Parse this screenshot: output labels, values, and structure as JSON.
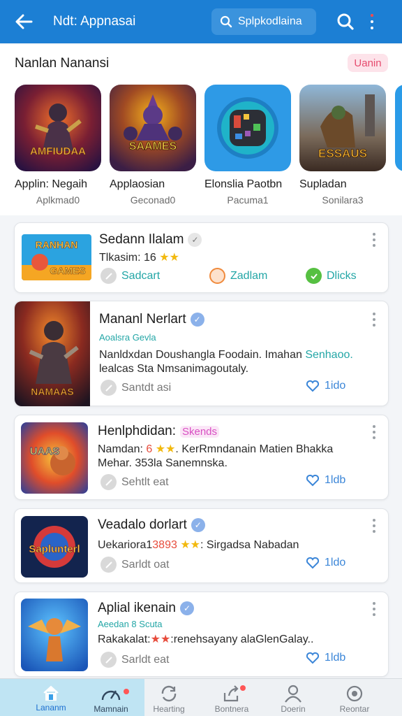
{
  "header": {
    "title": "Ndt: Appnasai",
    "search_label": "Splpkodlaina"
  },
  "featured": {
    "section_title": "Nanlan Nanansi",
    "badge": "Uanin",
    "tiles": [
      {
        "title": "Applin: Negaih",
        "subtitle": "Aplkmad0",
        "art_text": "AMFIUDAA"
      },
      {
        "title": "Applaosian",
        "subtitle": "Geconad0",
        "art_text": "SAAMES"
      },
      {
        "title": "Elonslia Paotbn",
        "subtitle": "Pacuma1",
        "art_text": ""
      },
      {
        "title": "Supladan",
        "subtitle": "Sonilara3",
        "art_text": "ESSAUS"
      }
    ]
  },
  "apps": [
    {
      "title": "Sedann Ilalam",
      "meta_prefix": "Tlkasim: 16",
      "art_line1": "RANHAN",
      "art_line2": "GAMES",
      "actions": [
        "Sadcart",
        "Zadlam",
        "Dlicks"
      ]
    },
    {
      "title": "Mananl Nerlart",
      "developer": "Aoalsra Gevla",
      "desc_line1_a": "Nanldxdan Doushangla Foodain. Imahan ",
      "desc_line1_b": "Senhaoo.",
      "desc_line2": "lealcas Sta Nmsanimagoutaly.",
      "art_text": "NAMAAS",
      "action_left": "Santdt asi",
      "action_right": "1ido"
    },
    {
      "title": "Henlphdidan:",
      "tag": "Skends",
      "desc_line1_a": "Namdan: ",
      "desc_line1_num": "6",
      "desc_line1_b": " KerRmndanain Matien Bhakka",
      "desc_line2": "Mehar. 353la Sanemnska.",
      "art_text": "UAAS",
      "action_left": "Sehtlt eat",
      "action_right": "1ldb"
    },
    {
      "title": "Veadalo dorlart",
      "meta_prefix": "Uekariora1",
      "meta_num": "3893",
      "meta_suffix": ": Sirgadsa Nabadan",
      "art_text": "Saplunterl",
      "action_left": "Sarldt oat",
      "action_right": "1ldo"
    },
    {
      "title": "Aplial ikenain",
      "developer": "Aeedan 8 Scuta",
      "desc_prefix": "Rakakalat:",
      "desc_suffix": ":renehsayany alaGlenGalay..",
      "action_left": "Sarldt eat",
      "action_right": "1ldb"
    }
  ],
  "bottom_nav": [
    {
      "label": "Lananm",
      "icon": "home-icon"
    },
    {
      "label": "Mamnain",
      "icon": "gauge-icon"
    },
    {
      "label": "Hearting",
      "icon": "refresh-icon"
    },
    {
      "label": "Bontnera",
      "icon": "share-icon"
    },
    {
      "label": "Doerin",
      "icon": "profile-icon"
    },
    {
      "label": "Reontar",
      "icon": "settings-icon"
    }
  ],
  "colors": {
    "header_bg": "#1c7fd4",
    "accent_teal": "#23a6a6",
    "badge_pink": "#e64b6e",
    "star_gold": "#f2b90f"
  }
}
